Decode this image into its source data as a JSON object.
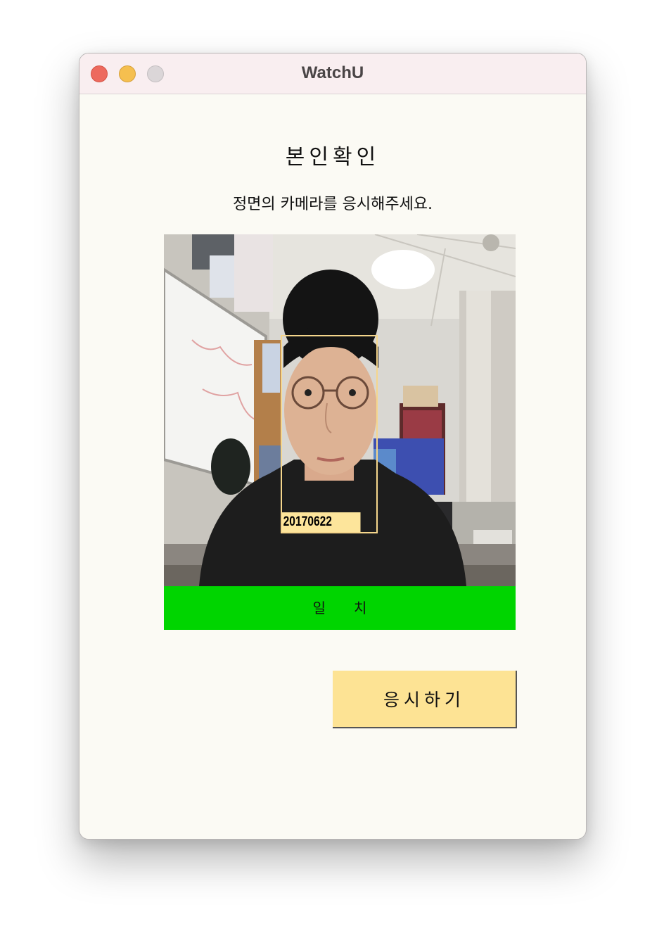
{
  "window": {
    "title": "WatchU"
  },
  "main": {
    "heading": "본인확인",
    "instruction": "정면의 카메라를 응시해주세요."
  },
  "camera": {
    "detected_id": "20170622",
    "match_status": "일치",
    "status_color": "#00d500",
    "box_color": "#f5d68c"
  },
  "actions": {
    "start_label": "응시하기",
    "button_color": "#fde394"
  },
  "icons": [
    "close-icon",
    "minimize-icon",
    "maximize-icon"
  ]
}
